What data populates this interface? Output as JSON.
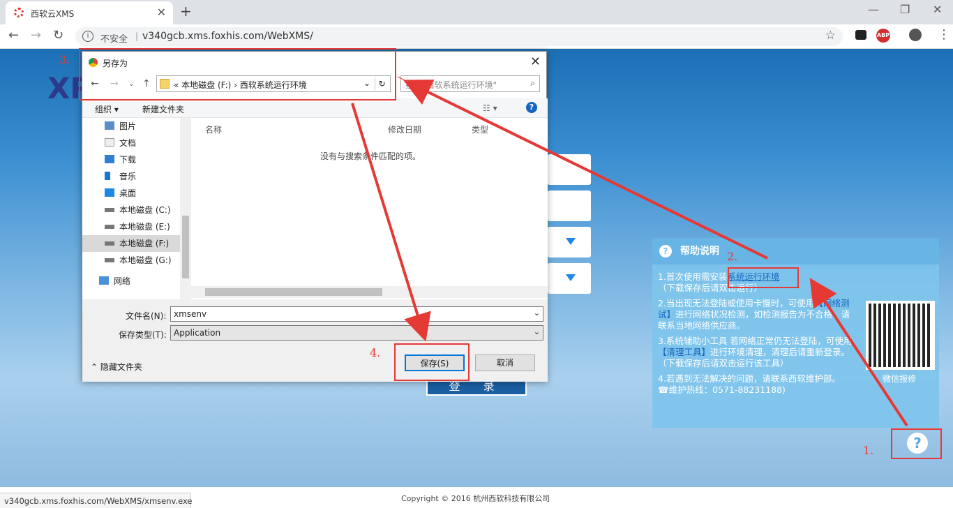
{
  "browser": {
    "tab_title": "西软云XMS",
    "insecure_label": "不安全",
    "url": "v340gcb.xms.foxhis.com/WebXMS/",
    "status_url": "v340gcb.xms.foxhis.com/WebXMS/xmsenv.exe",
    "abp_label": "ABP"
  },
  "page": {
    "logo": "XR",
    "login_button": "登 录",
    "copyright": "Copyright © 2016 杭州西软科技有限公司"
  },
  "help": {
    "title": "帮助说明",
    "item1_pre": "1.首次使用需安装",
    "item1_link": "系统运行环境",
    "item1_note": "（下载保存后请双击运行）",
    "item2_pre": "2.当出现无法登陆或使用卡慢时，可使用",
    "item2_link": "【网络测试】",
    "item2_post": "进行网络状况检测，如检测报告为不合格，请联系当地网络供应商。",
    "item3_pre": "3.系统辅助小工具 若网络正常仍无法登陆，可使用",
    "item3_link": "【清理工具】",
    "item3_post": "进行环境清理，清理后请重新登录。",
    "item3_note": "（下载保存后请双击运行该工具）",
    "item4": "4.若遇到无法解决的问题，请联系西软维护部。",
    "hotline": "☎维护热线：0571-88231188)",
    "qr_label": "微信报修"
  },
  "annotations": {
    "n1": "1.",
    "n2": "2.",
    "n3": "3.",
    "n4": "4."
  },
  "dialog": {
    "title": "另存为",
    "breadcrumb": "« 本地磁盘 (F:) › 西软系统运行环境",
    "search_placeholder": "搜索\"西软系统运行环境\"",
    "organize": "组织 ▾",
    "new_folder": "新建文件夹",
    "nav_items": [
      "图片",
      "文档",
      "下载",
      "音乐",
      "桌面",
      "本地磁盘 (C:)",
      "本地磁盘 (E:)",
      "本地磁盘 (F:)",
      "本地磁盘 (G:)",
      "网络"
    ],
    "col_name": "名称",
    "col_date": "修改日期",
    "col_type": "类型",
    "empty_msg": "没有与搜索条件匹配的项。",
    "filename_label": "文件名(N):",
    "filename_value": "xmsenv",
    "filetype_label": "保存类型(T):",
    "filetype_value": "Application",
    "hide_folders": "隐藏文件夹",
    "save": "保存(S)",
    "cancel": "取消"
  }
}
